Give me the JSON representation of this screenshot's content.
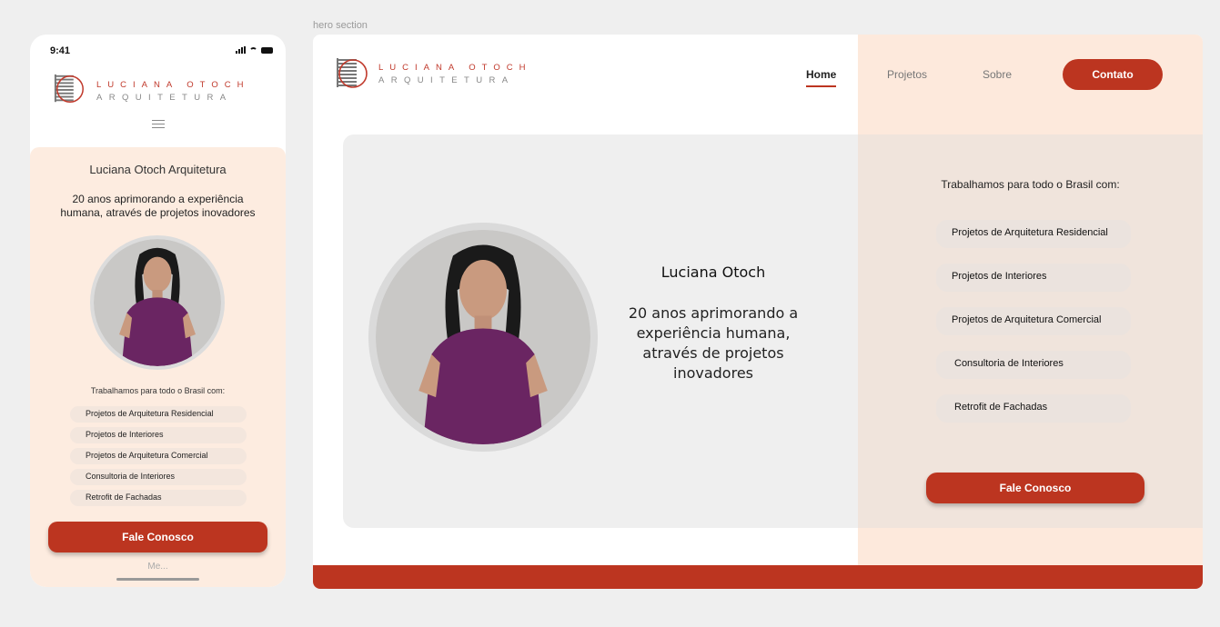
{
  "frame_label": "hero section",
  "colors": {
    "accent": "#bc3520",
    "peach": "#fde9dc",
    "card": "#efefef",
    "chip": "#ebe3de"
  },
  "brand": {
    "name": "LUCIANA OTOCH",
    "tagline": "ARQUITETURA"
  },
  "mobile": {
    "status_time": "9:41",
    "menu_icon": "hamburger-icon",
    "title": "Luciana Otoch Arquitetura",
    "subtitle": "20 anos aprimorando a experiência humana, através de projetos inovadores",
    "work_title": "Trabalhamos para todo o Brasil com:",
    "services": [
      "Projetos de Arquitetura Residencial",
      "Projetos de Interiores",
      "Projetos de Arquitetura Comercial",
      "Consultoria de Interiores",
      "Retrofit de Fachadas"
    ],
    "cta_label": "Fale Conosco",
    "more_label": "Me..."
  },
  "desktop": {
    "nav": {
      "home": "Home",
      "projects": "Projetos",
      "about": "Sobre",
      "contact": "Contato",
      "active": "Home"
    },
    "name": "Luciana Otoch",
    "subtitle": "20 anos aprimorando a experiência humana, através de projetos inovadores",
    "work_title": "Trabalhamos para todo o Brasil com:",
    "services": [
      "Projetos de Arquitetura Residencial",
      "Projetos de Interiores",
      "Projetos de Arquitetura Comercial",
      "Consultoria de Interiores",
      "Retrofit de Fachadas"
    ],
    "cta_label": "Fale Conosco"
  }
}
